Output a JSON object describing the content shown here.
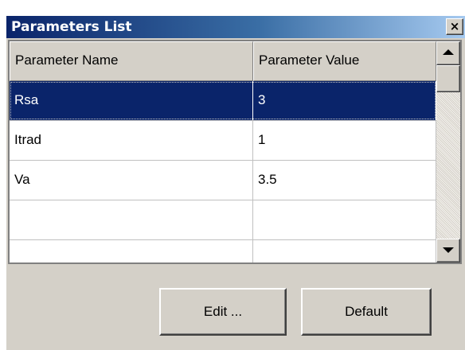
{
  "window": {
    "title": "Parameters List",
    "close_label": "×"
  },
  "grid": {
    "columns": [
      "Parameter Name",
      "Parameter Value"
    ],
    "rows": [
      {
        "name": "Rsa",
        "value": "3",
        "selected": true
      },
      {
        "name": "Itrad",
        "value": "1",
        "selected": false
      },
      {
        "name": "Va",
        "value": "3.5",
        "selected": false
      },
      {
        "name": "",
        "value": "",
        "selected": false
      },
      {
        "name": "",
        "value": "",
        "selected": false
      }
    ],
    "selection_color": "#0a246a"
  },
  "scrollbar": {
    "up_icon": "arrow-up-icon",
    "down_icon": "arrow-down-icon"
  },
  "buttons": {
    "edit_label": "Edit ...",
    "default_label": "Default"
  },
  "colors": {
    "title_gradient_start": "#0a246a",
    "title_gradient_end": "#a6caf0",
    "face": "#d4d0c8"
  }
}
